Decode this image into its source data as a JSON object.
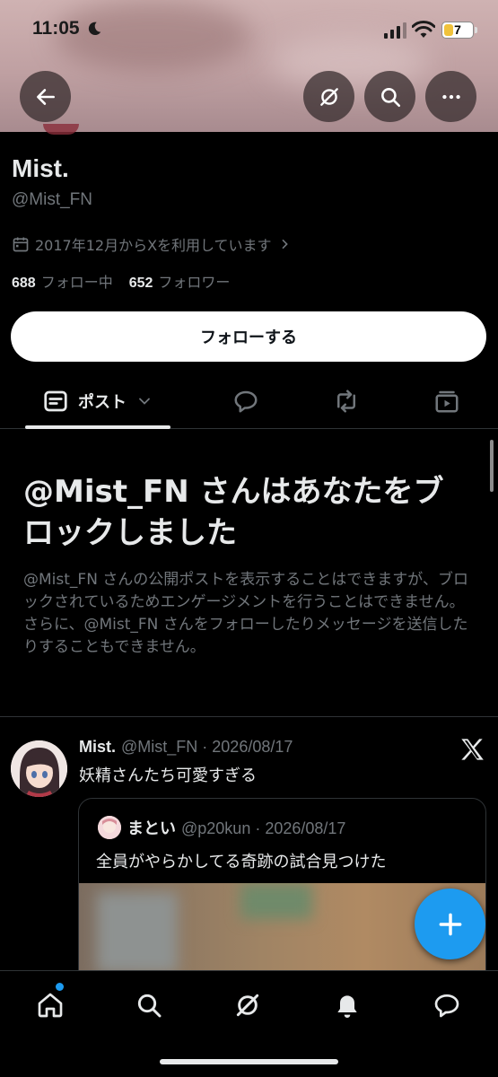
{
  "status_bar": {
    "time": "11:05",
    "battery": "7"
  },
  "profile": {
    "display_name": "Mist.",
    "handle": "@Mist_FN",
    "joined": "2017年12月からXを利用しています",
    "following_count": "688",
    "following_label": "フォロー中",
    "followers_count": "652",
    "followers_label": "フォロワー",
    "follow_button": "フォローする"
  },
  "tabs": {
    "posts_label": "ポスト"
  },
  "blocked": {
    "title": "@Mist_FN さんはあなたをブロックしました",
    "body": "@Mist_FN さんの公開ポストを表示することはできますが、ブロックされているためエンゲージメントを行うことはできません。さらに、@Mist_FN さんをフォローしたりメッセージを送信したりすることもできません。"
  },
  "post": {
    "author_name": "Mist.",
    "author_meta": "@Mist_FN · 2026/08/17",
    "text": "妖精さんたち可愛すぎる",
    "quote": {
      "author_name": "まとい",
      "author_meta": "@p20kun · 2026/08/17",
      "text": "全員がやらかしてる奇跡の試合見つけた"
    }
  },
  "colors": {
    "accent": "#1d9bf0",
    "background": "#000000",
    "muted": "#71767b"
  },
  "icons": [
    "back-arrow-icon",
    "grok-icon",
    "search-icon",
    "more-icon",
    "calendar-icon",
    "chevron-right-icon",
    "posts-icon",
    "chevron-down-icon",
    "reply-icon",
    "repost-icon",
    "media-icon",
    "x-logo-icon",
    "compose-plus-icon",
    "home-icon",
    "notifications-icon",
    "messages-icon"
  ]
}
